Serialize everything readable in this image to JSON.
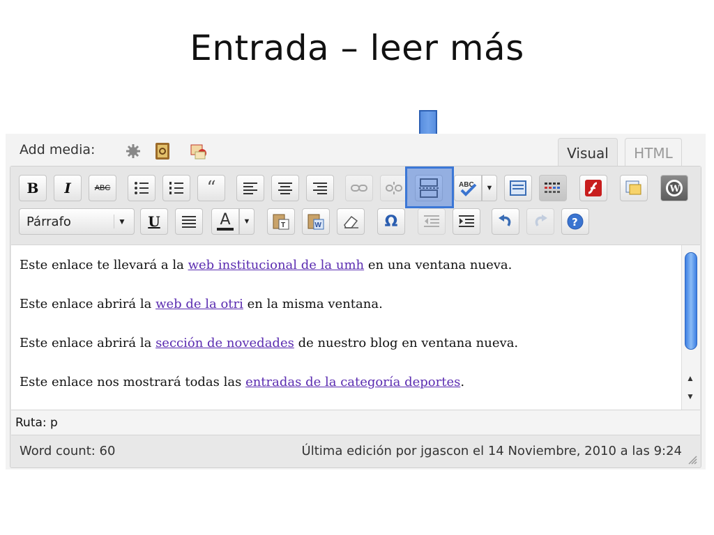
{
  "slide": {
    "title": "Entrada – leer más"
  },
  "media_bar": {
    "label": "Add media:",
    "icons": [
      "gear-icon",
      "address-book-icon",
      "image-icon"
    ]
  },
  "tabs": [
    {
      "label": "Visual",
      "active": true
    },
    {
      "label": "HTML",
      "active": false
    }
  ],
  "toolbar": {
    "bold": "B",
    "italic": "I",
    "strike": "ABC",
    "format_value": "Párrafo",
    "underline": "U",
    "font_color": "A",
    "special_char": "Ω",
    "highlighted_button": "insert-more-tag-button",
    "highlight_color": "#3b77d6"
  },
  "content": {
    "paragraphs": [
      {
        "before": "Este enlace te llevará a la ",
        "link": "web institucional de la umh",
        "after": " en una ventana nueva."
      },
      {
        "before": "Este enlace abrirá la ",
        "link": "web de la otri",
        "after": " en la misma ventana."
      },
      {
        "before": "Este enlace abrirá la ",
        "link": "sección de novedades",
        "after": " de nuestro blog en ventana nueva."
      },
      {
        "before": "Este enlace nos mostrará todas las ",
        "link": "entradas de la categoría deportes",
        "after": "."
      }
    ],
    "link_color": "#5a2bb0"
  },
  "path": {
    "text": "Ruta: p"
  },
  "status": {
    "word_count": "Word count: 60",
    "last_edit": "Última edición por jgascon el 14 Noviembre, 2010 a las 9:24"
  }
}
